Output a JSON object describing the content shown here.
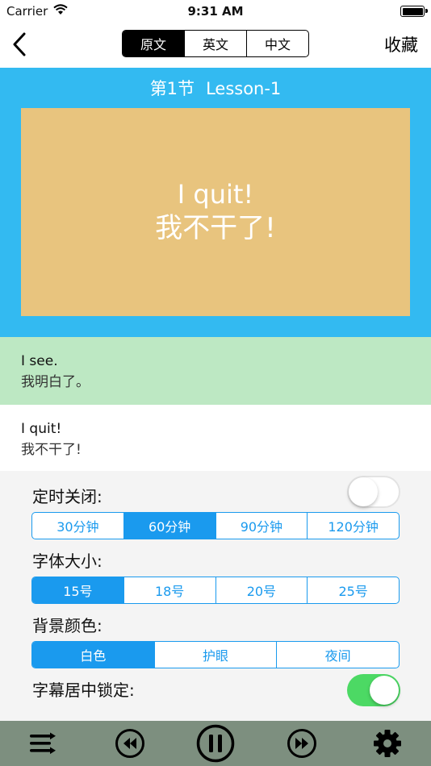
{
  "status_bar": {
    "carrier": "Carrier",
    "time": "9:31 AM"
  },
  "nav": {
    "tabs": [
      "原文",
      "英文",
      "中文"
    ],
    "active_tab": 0,
    "favorite_label": "收藏"
  },
  "lesson": {
    "section": "第1节",
    "name": "Lesson-1",
    "current_caption": {
      "en": "I quit!",
      "zh": "我不干了!"
    }
  },
  "subtitles": [
    {
      "en": "I see.",
      "zh": "我明白了。",
      "highlighted": true
    },
    {
      "en": "I quit!",
      "zh": "我不干了!",
      "highlighted": false
    }
  ],
  "settings": {
    "timer": {
      "label": "定时关闭:",
      "enabled": false,
      "options": [
        "30分钟",
        "60分钟",
        "90分钟",
        "120分钟"
      ],
      "selected": 1
    },
    "font_size": {
      "label": "字体大小:",
      "options": [
        "15号",
        "18号",
        "20号",
        "25号"
      ],
      "selected": 0
    },
    "background": {
      "label": "背景颜色:",
      "options": [
        "白色",
        "护眼",
        "夜间"
      ],
      "selected": 0
    },
    "lock_center": {
      "label": "字幕居中锁定:",
      "enabled": true
    }
  },
  "player": {
    "icons": [
      "playlist-icon",
      "rewind-icon",
      "pause-icon",
      "fast-forward-icon",
      "gear-icon"
    ]
  },
  "colors": {
    "panel_blue": "#33baf1",
    "caption_tan": "#e8c47e",
    "highlight_green": "#bde8c3",
    "accent_blue": "#1a9aee",
    "toggle_green": "#4cd964",
    "player_bar": "#7d8f7f"
  }
}
